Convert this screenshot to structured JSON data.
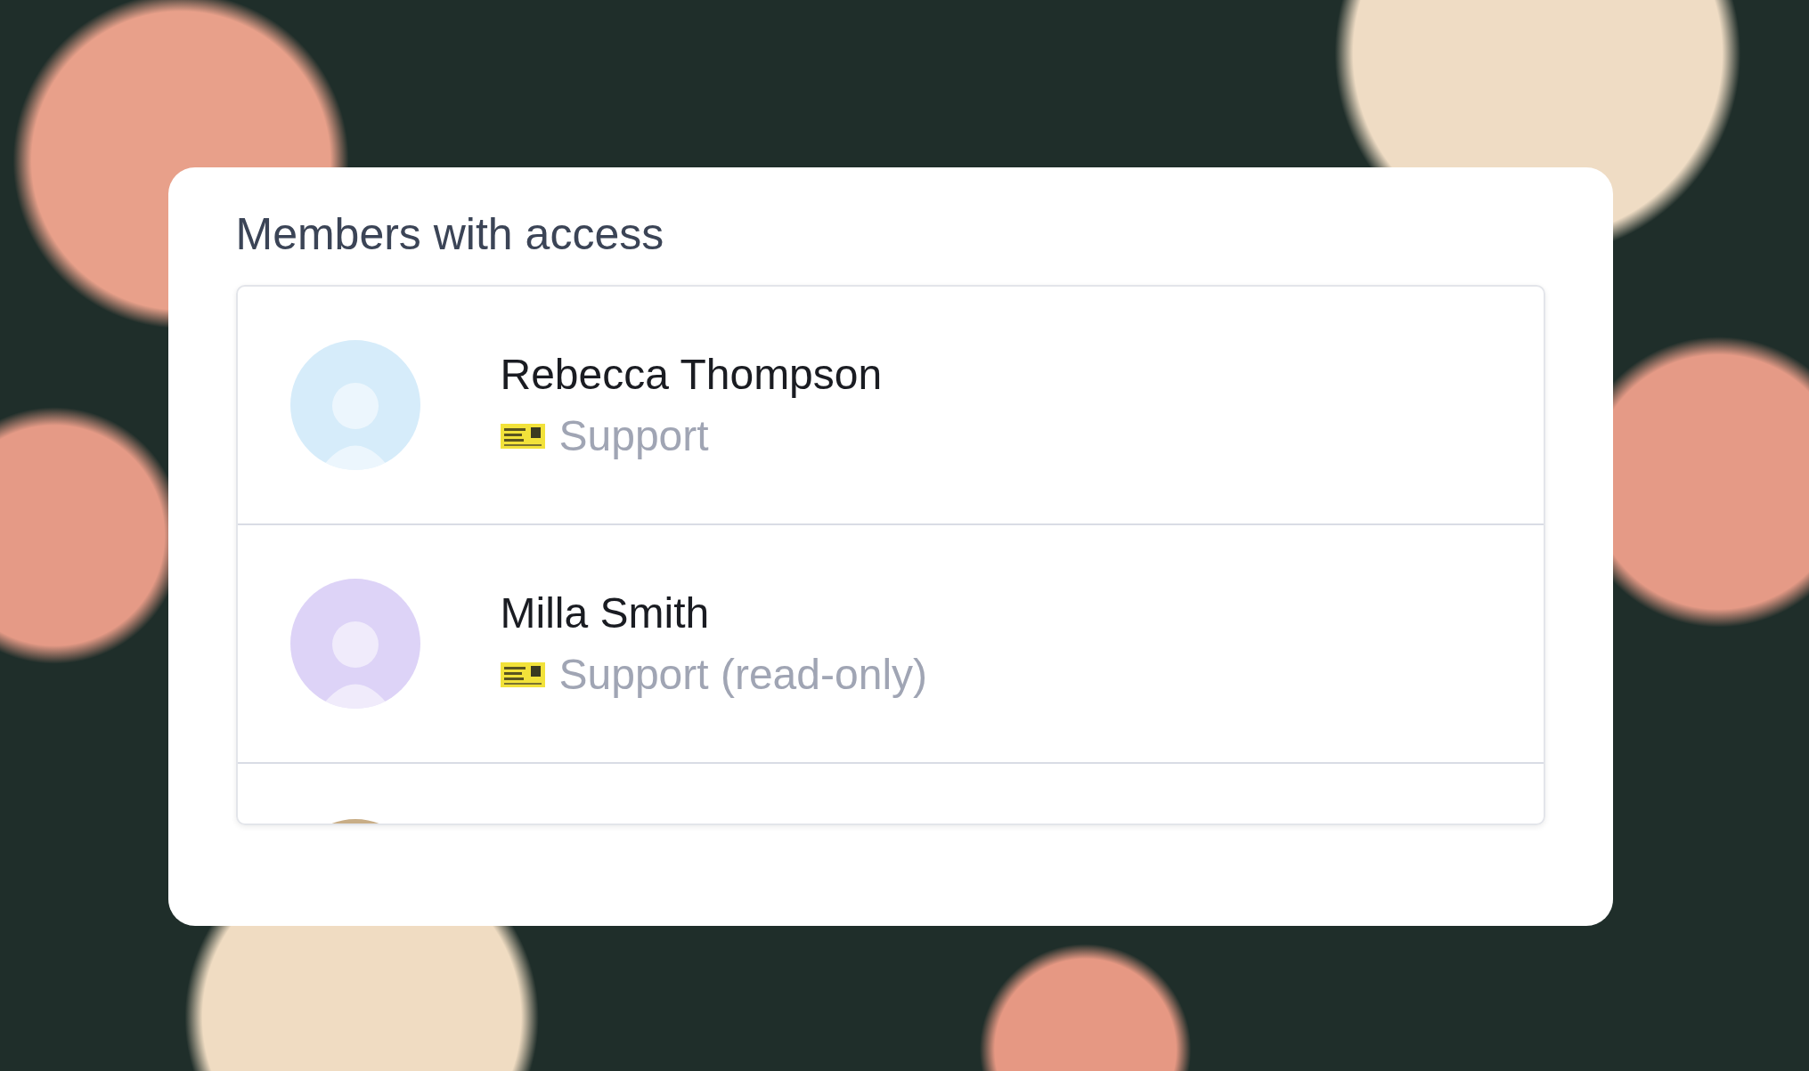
{
  "card": {
    "title": "Members with access"
  },
  "members": [
    {
      "name": "Rebecca Thompson",
      "role": "Support",
      "color": "#d6ecfa"
    },
    {
      "name": "Milla Smith",
      "role": "Support (read-only)",
      "color": "#ddd3f7"
    },
    {
      "color": "#c8ad86"
    }
  ]
}
